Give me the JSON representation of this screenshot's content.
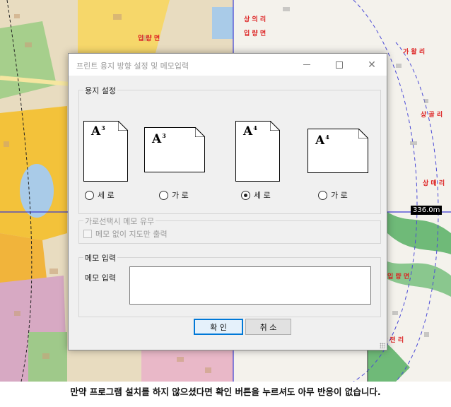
{
  "dialog": {
    "title": "프린트 용지 방향 설정 및 메모입력",
    "window_controls": {
      "minimize_icon": "minimize-icon",
      "maximize_icon": "maximize-icon",
      "close_glyph": "✕"
    },
    "paper_group": {
      "legend": "용지 설정",
      "options": [
        {
          "label_main": "A",
          "label_size": "3",
          "orientation_label": "세 로",
          "selected": false
        },
        {
          "label_main": "A",
          "label_size": "3",
          "orientation_label": "가 로",
          "selected": false
        },
        {
          "label_main": "A",
          "label_size": "4",
          "orientation_label": "세 로",
          "selected": true
        },
        {
          "label_main": "A",
          "label_size": "4",
          "orientation_label": "가 로",
          "selected": false
        }
      ]
    },
    "memo_option_group": {
      "legend": "가로선택시 메모 유무",
      "checkbox_label": "메모 없이 지도만 출력",
      "checked": false,
      "disabled": true
    },
    "memo_group": {
      "legend": "메모 입력",
      "field_label": "메모 입력",
      "value": ""
    },
    "buttons": {
      "ok_label": "확 인",
      "cancel_label": "취 소"
    }
  },
  "map": {
    "labels": [
      "입 량 면",
      "상 의 리",
      "입 량 면",
      "가 왈 리",
      "상 골 리",
      "상 매 리",
      "상 전 리",
      "입 량 면"
    ],
    "scale_readout": "336.0m",
    "accent_colors": {
      "road_yellow": "#f3c23a",
      "zone_pink": "#e9b8c8",
      "zone_green": "#9fc98a",
      "forest": "#6fba78",
      "water": "#a9cbe8"
    }
  },
  "caption": "만약 프로그램 설치를 하지 않으셨다면 확인 버튼을 누르셔도 아무 반응이 없습니다."
}
